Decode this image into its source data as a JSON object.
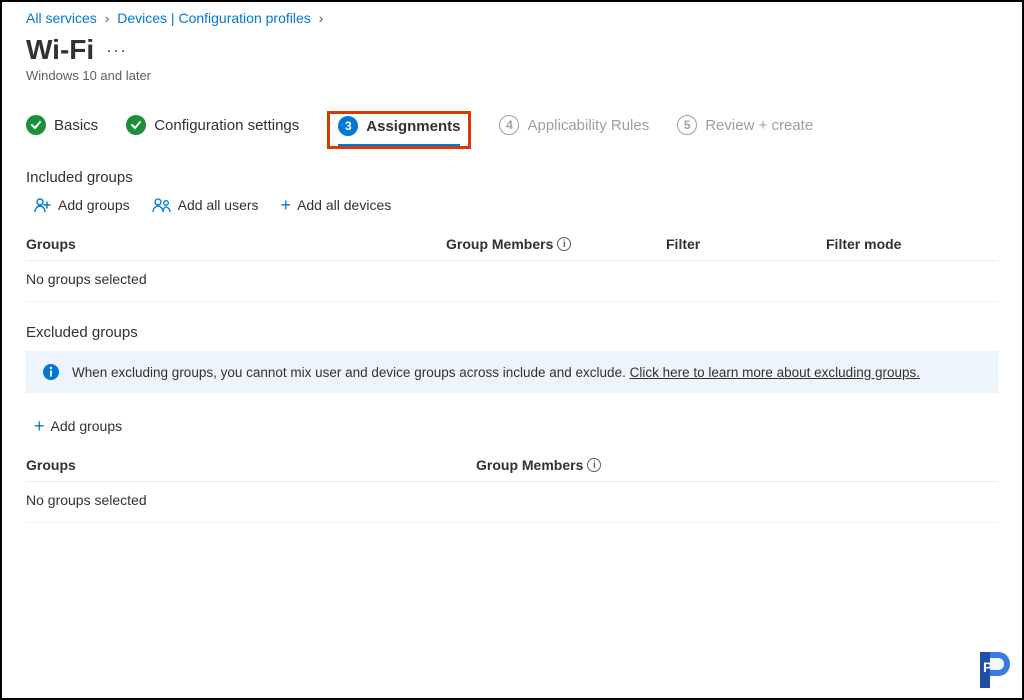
{
  "breadcrumb": {
    "item1": "All services",
    "item2": "Devices | Configuration profiles"
  },
  "header": {
    "title": "Wi-Fi",
    "subtitle": "Windows 10 and later"
  },
  "wizard": {
    "step1": "Basics",
    "step2": "Configuration settings",
    "step3_num": "3",
    "step3": "Assignments",
    "step4_num": "4",
    "step4": "Applicability Rules",
    "step5_num": "5",
    "step5": "Review + create"
  },
  "included": {
    "title": "Included groups",
    "add_groups": "Add groups",
    "add_all_users": "Add all users",
    "add_all_devices": "Add all devices",
    "col_groups": "Groups",
    "col_members": "Group Members",
    "col_filter": "Filter",
    "col_filtermode": "Filter mode",
    "empty": "No groups selected"
  },
  "excluded": {
    "title": "Excluded groups",
    "banner_text": "When excluding groups, you cannot mix user and device groups across include and exclude. ",
    "banner_link": "Click here to learn more about excluding groups.",
    "add_groups": "Add groups",
    "col_groups": "Groups",
    "col_members": "Group Members",
    "empty": "No groups selected"
  }
}
